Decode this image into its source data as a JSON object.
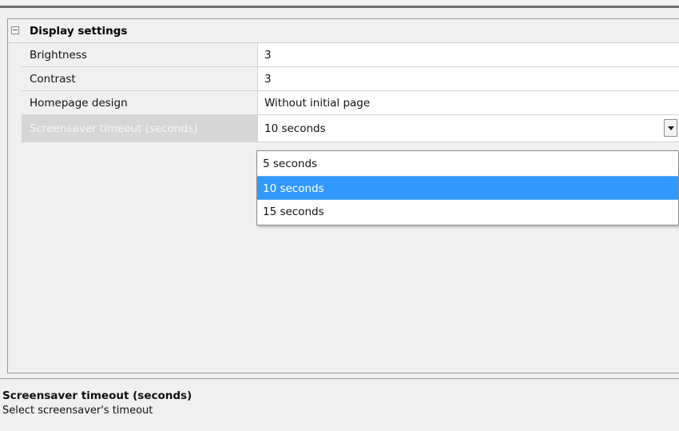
{
  "category": {
    "label": "Display settings"
  },
  "properties": [
    {
      "name": "Brightness",
      "value": "3"
    },
    {
      "name": "Contrast",
      "value": "3"
    },
    {
      "name": "Homepage design",
      "value": "Without initial page"
    },
    {
      "name": "Screensaver timeout (seconds)",
      "value": "10 seconds"
    }
  ],
  "dropdown": {
    "options": [
      "5 seconds",
      "10 seconds",
      "15 seconds"
    ],
    "selected": "10 seconds"
  },
  "description": {
    "title": "Screensaver timeout (seconds)",
    "text": "Select screensaver's timeout"
  }
}
